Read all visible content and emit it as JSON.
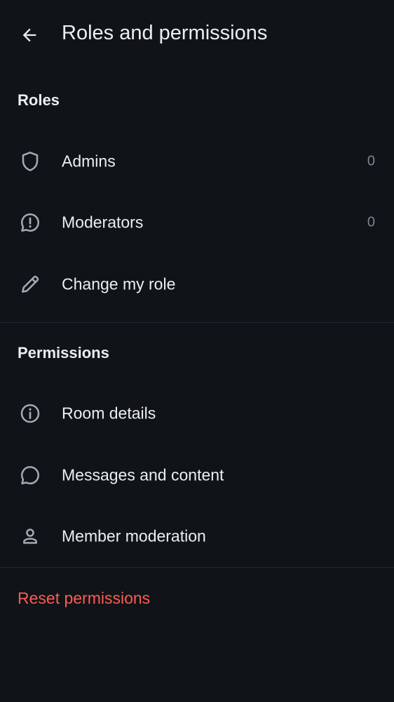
{
  "header": {
    "title": "Roles and permissions"
  },
  "roles": {
    "section_title": "Roles",
    "items": [
      {
        "label": "Admins",
        "count": "0",
        "icon": "shield-icon"
      },
      {
        "label": "Moderators",
        "count": "0",
        "icon": "alert-chat-icon"
      },
      {
        "label": "Change my role",
        "icon": "pencil-icon"
      }
    ]
  },
  "permissions": {
    "section_title": "Permissions",
    "items": [
      {
        "label": "Room details",
        "icon": "info-icon"
      },
      {
        "label": "Messages and content",
        "icon": "chat-bubble-icon"
      },
      {
        "label": "Member moderation",
        "icon": "user-icon"
      }
    ]
  },
  "reset": {
    "label": "Reset permissions"
  },
  "colors": {
    "background": "#101317",
    "text": "#ebeef2",
    "icon": "#a3aab3",
    "secondary": "#7f868f",
    "divider": "#23272e",
    "destructive": "#ff5b55"
  }
}
